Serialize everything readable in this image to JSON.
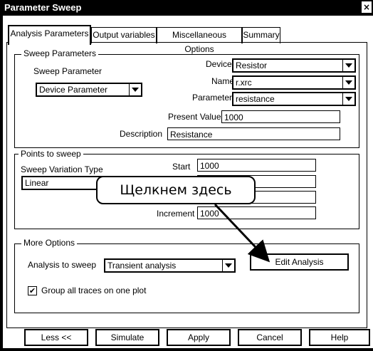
{
  "window": {
    "title": "Parameter Sweep",
    "close_glyph": "×"
  },
  "tabs": [
    {
      "label": "Analysis Parameters",
      "active": true
    },
    {
      "label": "Output variables",
      "active": false
    },
    {
      "label": "Miscellaneous Options",
      "active": false
    },
    {
      "label": "Summary",
      "active": false
    }
  ],
  "sweep_parameters": {
    "legend": "Sweep Parameters",
    "sweep_parameter_label": "Sweep Parameter",
    "sweep_parameter_value": "Device Parameter",
    "device_label": "Device",
    "device_value": "Resistor",
    "name_label": "Name",
    "name_value": "r.xrc",
    "parameter_label": "Parameter",
    "parameter_value": "resistance",
    "present_value_label": "Present Value",
    "present_value": "1000",
    "description_label": "Description",
    "description_value": "Resistance"
  },
  "points_to_sweep": {
    "legend": "Points to sweep",
    "variation_type_label": "Sweep Variation Type",
    "variation_type_value": "Linear",
    "start_label": "Start",
    "start_value": "1000",
    "increment_label": "Increment",
    "increment_value": "1000"
  },
  "callout": {
    "text": "Щелкнем здесь"
  },
  "more_options": {
    "legend": "More Options",
    "analysis_to_sweep_label": "Analysis to sweep",
    "analysis_to_sweep_value": "Transient analysis",
    "edit_analysis_label": "Edit Analysis",
    "group_traces_label": "Group all traces on one plot",
    "group_traces_checked": true,
    "check_glyph": "✔"
  },
  "buttons": {
    "less": "Less <<",
    "simulate": "Simulate",
    "apply": "Apply",
    "cancel": "Cancel",
    "help": "Help"
  }
}
